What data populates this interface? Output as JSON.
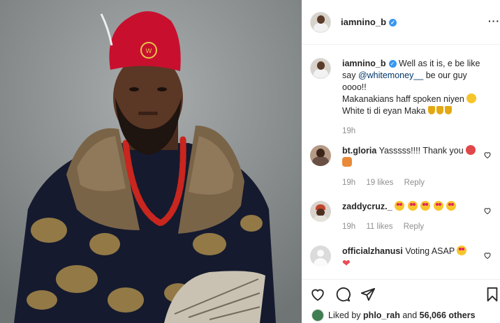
{
  "post": {
    "username": "iamnino_b",
    "more_icon": "more-horizontal-icon",
    "photo_subject": "portrait",
    "caption": {
      "text_1": "Well as it is, e be like say",
      "mention": "@whitemoney__",
      "text_2": "be our guy oooo!!",
      "line_2": "Makanakians haff spoken niyen",
      "line_3": "White ti di eyan Maka",
      "time": "19h"
    }
  },
  "comments": [
    {
      "username": "bt.gloria",
      "text": "Yasssss!!!! Thank you",
      "time": "19h",
      "likes": "19 likes",
      "reply": "Reply"
    },
    {
      "username": "zaddycruz._",
      "text": "",
      "time": "19h",
      "likes": "11 likes",
      "reply": "Reply"
    },
    {
      "username": "officialzhanusi",
      "text": "Voting ASAP",
      "time": "",
      "likes": "",
      "reply": ""
    }
  ],
  "actions": {
    "like_icon": "heart-icon",
    "comment_icon": "comment-icon",
    "share_icon": "send-icon",
    "save_icon": "bookmark-icon"
  },
  "liked_by": {
    "prefix": "Liked by",
    "user": "phlo_rah",
    "conj": "and",
    "count": "56,066 others"
  },
  "colors": {
    "verified": "#3897f0",
    "link": "#00376b",
    "meta": "#8e8e8e",
    "cap": "#d0102c"
  }
}
